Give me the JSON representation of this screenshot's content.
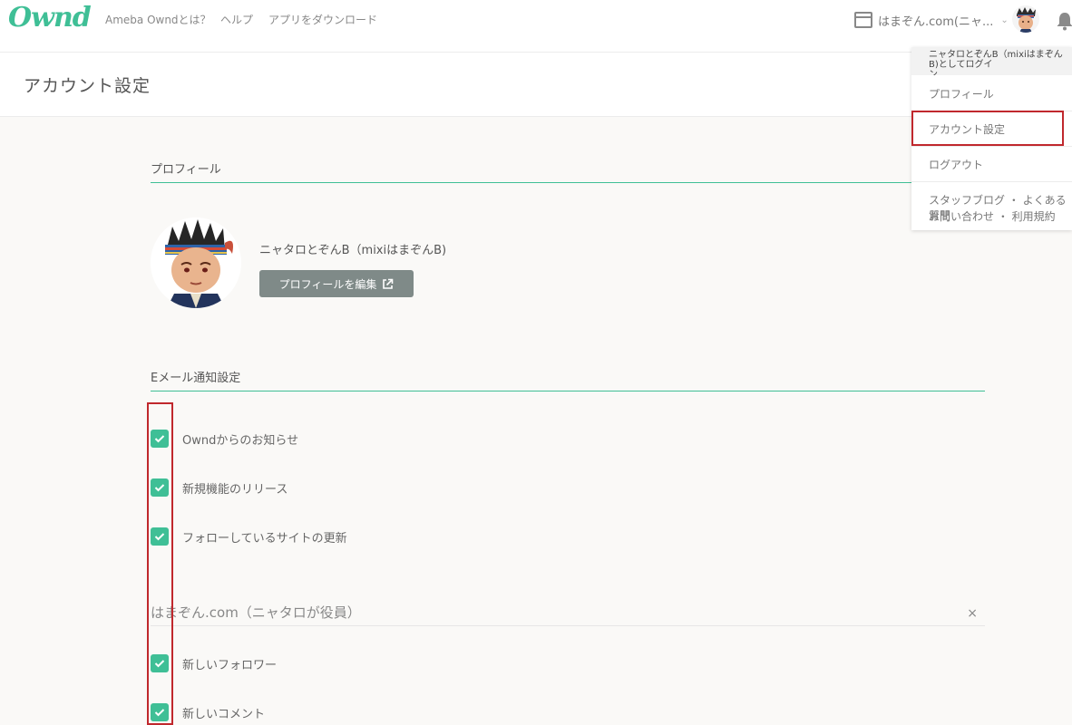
{
  "header": {
    "logo": "Ownd",
    "nav": [
      "Ameba Owndとは？",
      "ヘルプ",
      "アプリをダウンロード"
    ],
    "site_selector": "はまぞん.com(ニャ...",
    "icons": [
      "site-window-icon",
      "chevron-down-icon",
      "avatar",
      "bell-icon"
    ]
  },
  "page": {
    "title": "アカウント設定"
  },
  "profile": {
    "heading": "プロフィール",
    "name": "ニャタロとぞんB（mixiはまぞんB)",
    "edit_button": "プロフィールを編集"
  },
  "email": {
    "heading": "Eメール通知設定",
    "general": [
      {
        "label": "Owndからのお知らせ",
        "checked": true
      },
      {
        "label": "新規機能のリリース",
        "checked": true
      },
      {
        "label": "フォローしているサイトの更新",
        "checked": true
      }
    ],
    "site": {
      "name": "はまぞん.com（ニャタロが役員）",
      "close": "×",
      "items": [
        {
          "label": "新しいフォロワー",
          "checked": true
        },
        {
          "label": "新しいコメント",
          "checked": true
        }
      ]
    }
  },
  "dropdown": {
    "user": "ニャタロとぞんB（mixiはまぞんB)としてログイ\nン",
    "items": [
      "プロフィール",
      "アカウント設定",
      "ログアウト"
    ],
    "footer": [
      "スタッフブログ ・ よくある質問",
      "お問い合わせ ・ 利用規約"
    ]
  },
  "colors": {
    "accent": "#3fbf96",
    "highlight": "#c0282d",
    "button": "#7f8a88"
  }
}
